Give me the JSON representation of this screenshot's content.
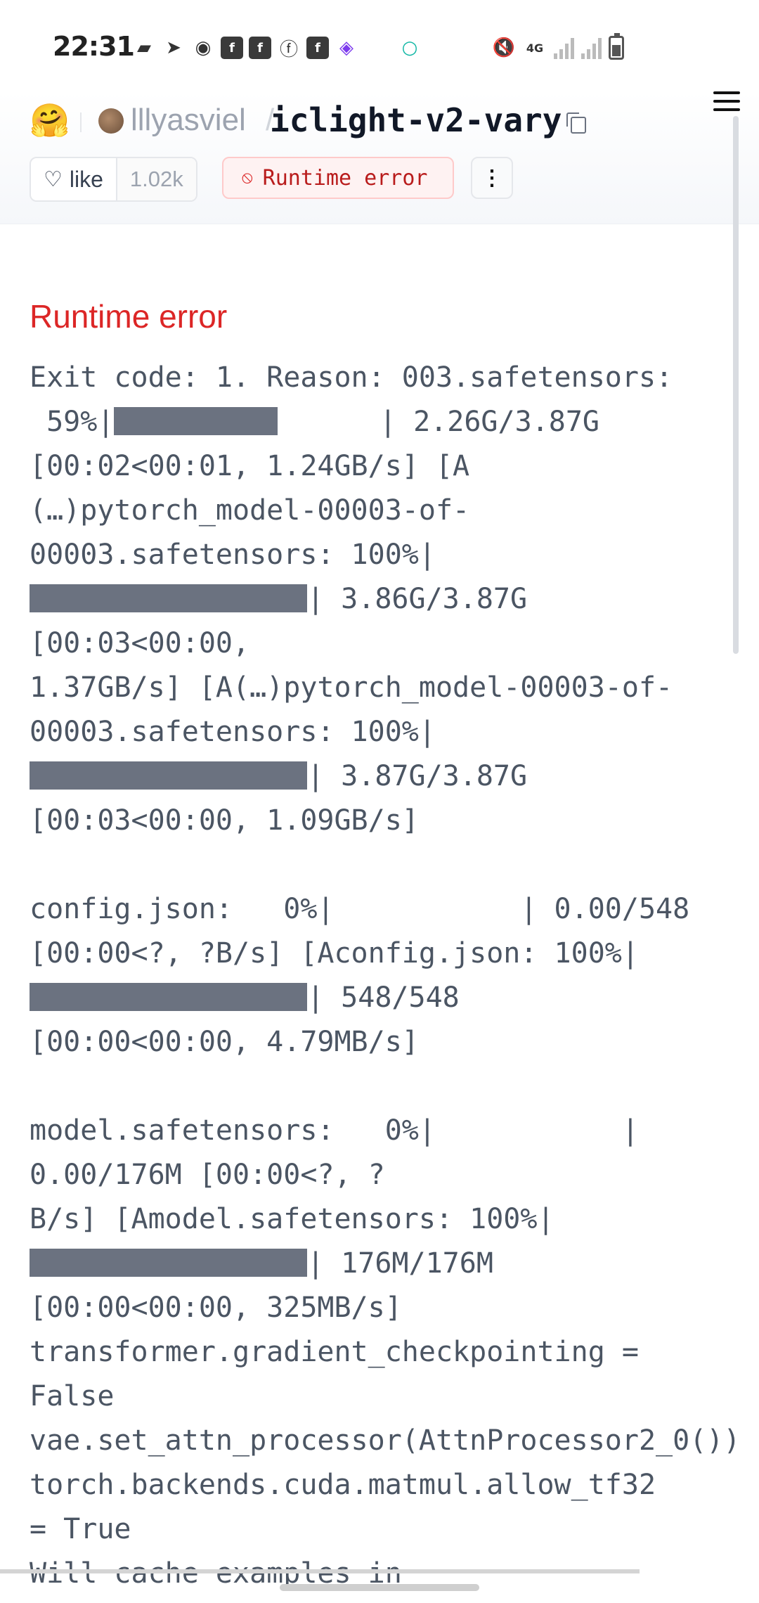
{
  "status_bar": {
    "time": "22:31",
    "network": "4G",
    "icons": [
      "message-icon",
      "send-icon",
      "discord-icon",
      "facebook-group-icon",
      "facebook-group-icon",
      "facebook-icon",
      "facebook-group-icon",
      "purple-app-icon",
      "teal-ring-icon",
      "mute-icon",
      "signal-icon",
      "signal-icon",
      "battery-icon"
    ]
  },
  "header": {
    "logo": "🤗",
    "owner": "lllyasviel",
    "separator": "/",
    "repo": "iclight-v2-vary",
    "like_label": "like",
    "like_count": "1.02k",
    "status_label": "Runtime error"
  },
  "content": {
    "error_title": "Runtime error",
    "log_lines": [
      "Exit code: 1. Reason: 003.safetensors:",
      " 59%|",
      "      | 2.26G/3.87G",
      "[00:02<00:01, 1.24GB/s] [A",
      "(…)pytorch_model-00003-of-",
      "00003.safetensors: 100%|",
      "| 3.86G/3.87G",
      "[00:03<00:00,",
      "1.37GB/s] [A(…)pytorch_model-00003-of-",
      "00003.safetensors: 100%|",
      "| 3.87G/3.87G",
      "[00:03<00:00, 1.09GB/s]",
      "config.json:   0%|           | 0.00/548",
      "[00:00<?, ?B/s] [Aconfig.json: 100%|",
      "| 548/548",
      "[00:00<00:00, 4.79MB/s]",
      "model.safetensors:   0%|           |",
      "0.00/176M [00:00<?, ?",
      "B/s] [Amodel.safetensors: 100%|",
      "| 176M/176M",
      "[00:00<00:00, 325MB/s]",
      "transformer.gradient_checkpointing =",
      "False",
      "vae.set_attn_processor(AttnProcessor2_0())",
      "torch.backends.cuda.matmul.allow_tf32",
      "= True",
      "Will cache examples in"
    ],
    "progress_bars": [
      0.59,
      1.0,
      1.0,
      1.0,
      1.0
    ]
  }
}
